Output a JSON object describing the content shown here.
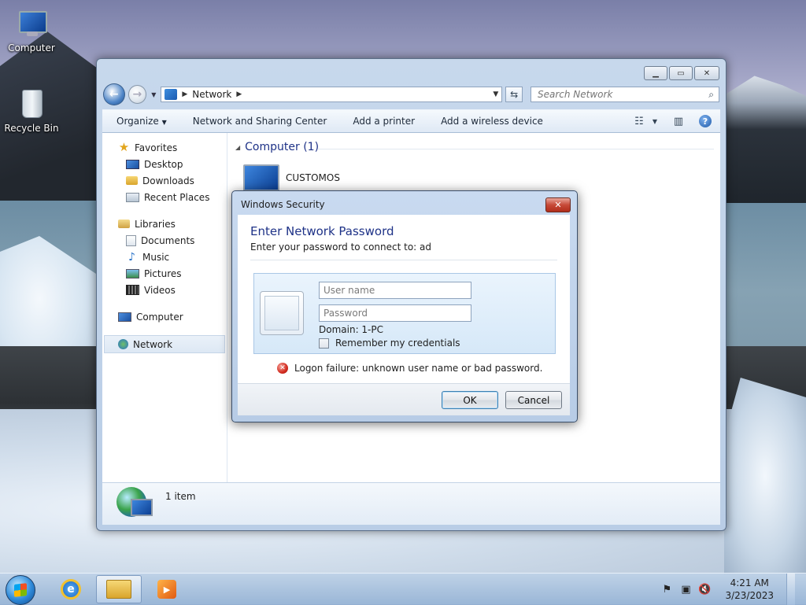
{
  "desktop": {
    "icons": [
      {
        "label": "Computer",
        "icon": "computer-icon"
      },
      {
        "label": "Recycle Bin",
        "icon": "recycle-bin-icon"
      }
    ]
  },
  "explorer": {
    "address": {
      "crumbs": [
        "Network"
      ]
    },
    "search": {
      "placeholder": "Search Network"
    },
    "toolbar": {
      "organize": "Organize",
      "network_sharing": "Network and Sharing Center",
      "add_printer": "Add a printer",
      "add_wireless": "Add a wireless device"
    },
    "nav": {
      "favorites": {
        "label": "Favorites",
        "items": [
          "Desktop",
          "Downloads",
          "Recent Places"
        ]
      },
      "libraries": {
        "label": "Libraries",
        "items": [
          "Documents",
          "Music",
          "Pictures",
          "Videos"
        ]
      },
      "computer": "Computer",
      "network": "Network"
    },
    "main": {
      "group_header": "Computer (1)",
      "items": [
        "CUSTOMOS"
      ]
    },
    "details": {
      "count": "1 item"
    }
  },
  "dialog": {
    "title": "Windows Security",
    "heading": "Enter Network Password",
    "subtitle": "Enter your password to connect to: ad",
    "username_placeholder": "User name",
    "password_placeholder": "Password",
    "domain": "Domain: 1-PC",
    "remember": "Remember my credentials",
    "error": "Logon failure: unknown user name or bad password.",
    "ok": "OK",
    "cancel": "Cancel"
  },
  "taskbar": {
    "time": "4:21 AM",
    "date": "3/23/2023"
  }
}
